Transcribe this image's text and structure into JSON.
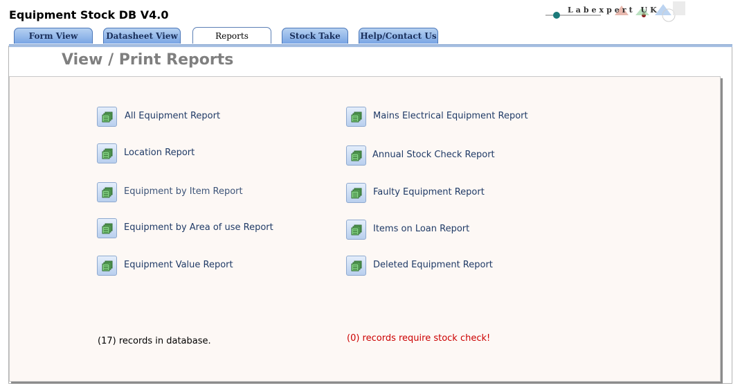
{
  "app": {
    "title": "Equipment Stock DB V4.0"
  },
  "logo": {
    "text": "Labexpert UK"
  },
  "tabs": [
    {
      "label": "Form View"
    },
    {
      "label": "Datasheet View"
    },
    {
      "label": "Reports"
    },
    {
      "label": "Stock Take"
    },
    {
      "label": "Help/Contact Us"
    }
  ],
  "page": {
    "title": "View / Print Reports"
  },
  "reports": {
    "left": [
      {
        "label": "All Equipment Report"
      },
      {
        "label": "Location Report"
      },
      {
        "label": "Equipment by Item Report"
      },
      {
        "label": "Equipment by Area of use Report"
      },
      {
        "label": "Equipment Value Report"
      }
    ],
    "right": [
      {
        "label": "Mains Electrical Equipment Report"
      },
      {
        "label": "Annual Stock Check Report"
      },
      {
        "label": "Faulty Equipment Report"
      },
      {
        "label": "Items on Loan Report"
      },
      {
        "label": "Deleted Equipment Report"
      }
    ]
  },
  "status": {
    "records": "(17) records in database.",
    "stock_check": "(0) records require stock check!",
    "stock_check_color": "#cc0000"
  },
  "icons": {
    "report": "report-stack-icon"
  }
}
